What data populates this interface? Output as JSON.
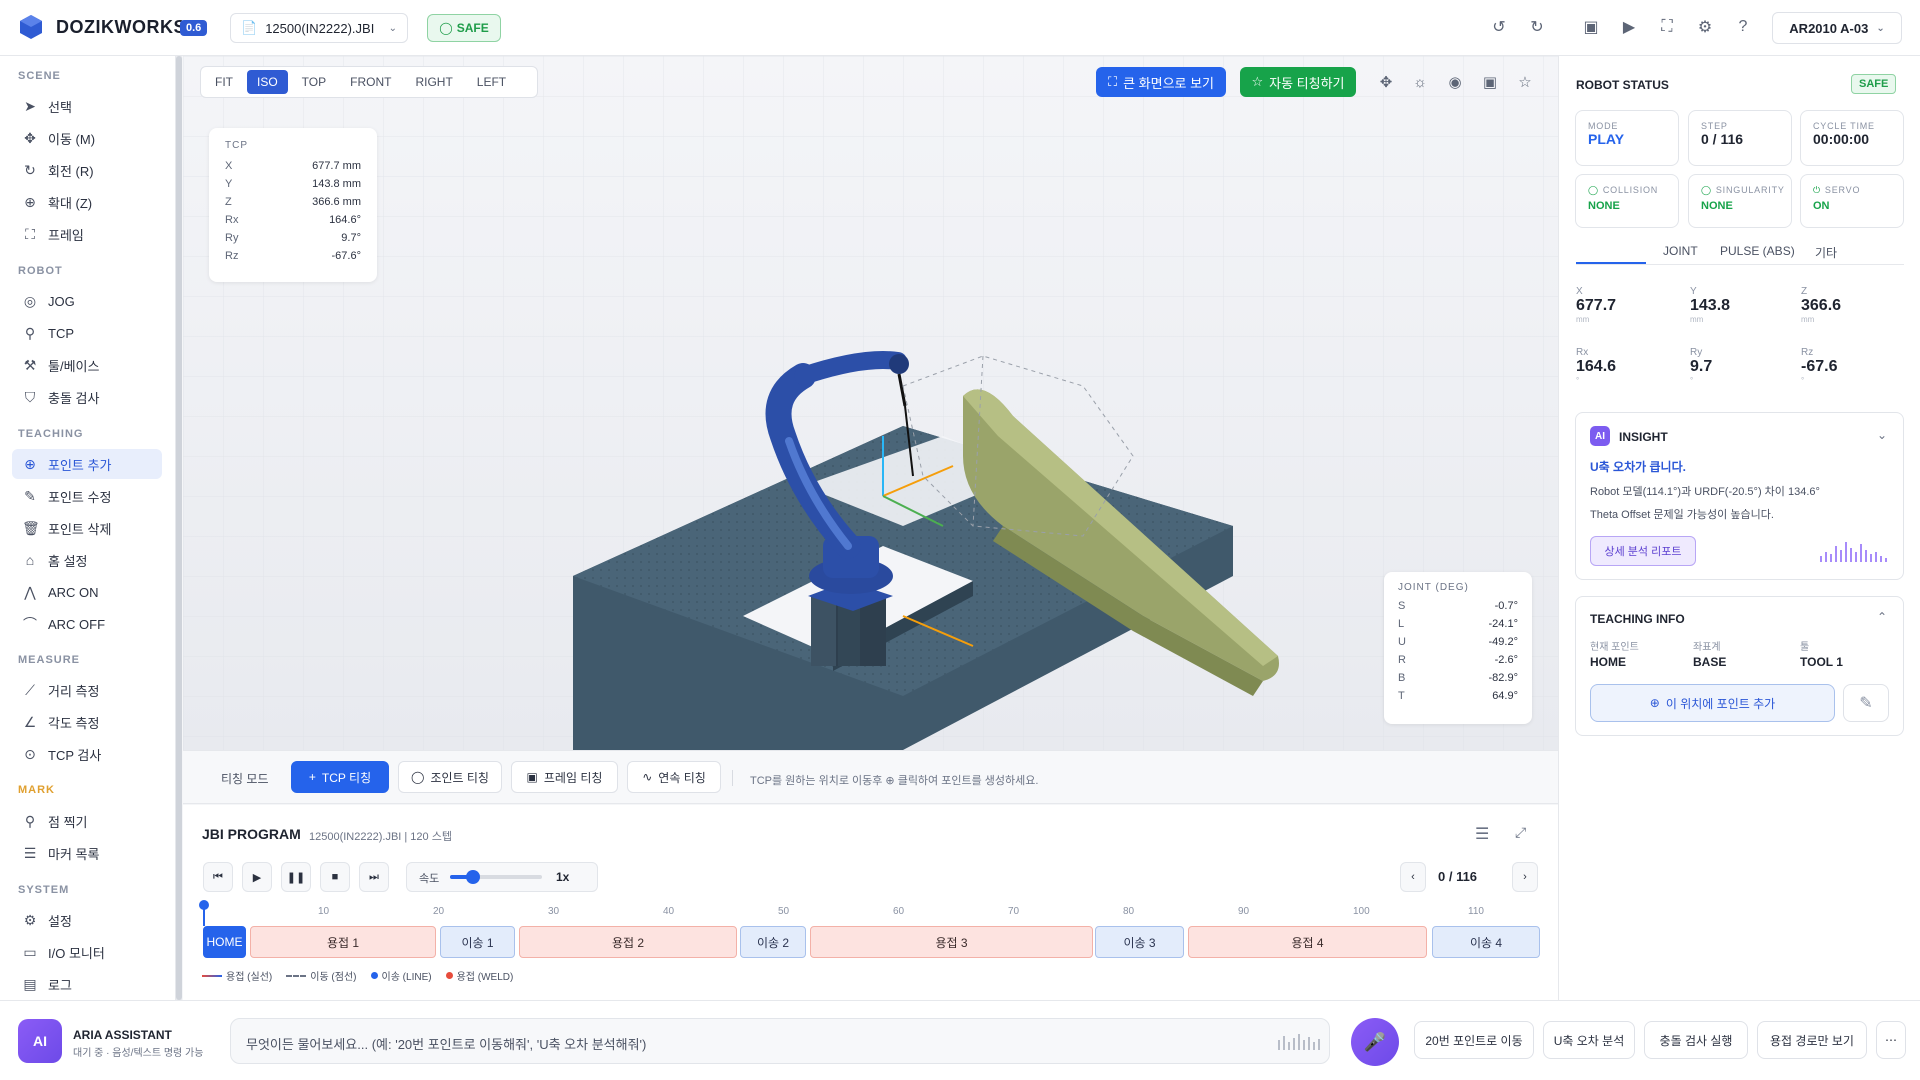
{
  "app": {
    "brand": "DOZIKWORKS",
    "version": "0.6",
    "file": "12500(IN2222).JBI",
    "safe": "SAFE",
    "robot_select": "AR2010 A-03"
  },
  "sidebar": {
    "sections": [
      {
        "title": "SCENE",
        "items": [
          {
            "label": "선택",
            "icon": "cursor-icon"
          },
          {
            "label": "이동 (M)",
            "icon": "move-icon"
          },
          {
            "label": "회전 (R)",
            "icon": "rotate-icon"
          },
          {
            "label": "확대 (Z)",
            "icon": "zoom-icon"
          },
          {
            "label": "프레임",
            "icon": "frame-icon"
          }
        ]
      },
      {
        "title": "ROBOT",
        "items": [
          {
            "label": "JOG",
            "icon": "jog-icon"
          },
          {
            "label": "TCP",
            "icon": "tcp-icon"
          },
          {
            "label": "툴/베이스",
            "icon": "wrench-icon"
          },
          {
            "label": "충돌 검사",
            "icon": "shield-icon"
          }
        ]
      },
      {
        "title": "TEACHING",
        "items": [
          {
            "label": "포인트 추가",
            "icon": "plus-circle-icon"
          },
          {
            "label": "포인트 수정",
            "icon": "edit-icon"
          },
          {
            "label": "포인트 삭제",
            "icon": "trash-icon"
          },
          {
            "label": "홈 설정",
            "icon": "home-icon"
          },
          {
            "label": "ARC ON",
            "icon": "arc-on-icon"
          },
          {
            "label": "ARC OFF",
            "icon": "arc-off-icon"
          }
        ]
      },
      {
        "title": "MEASURE",
        "items": [
          {
            "label": "거리 측정",
            "icon": "ruler-icon"
          },
          {
            "label": "각도 측정",
            "icon": "angle-icon"
          },
          {
            "label": "TCP 검사",
            "icon": "target-icon"
          }
        ]
      },
      {
        "title": "MARK",
        "items": [
          {
            "label": "점 찍기",
            "icon": "pin-icon"
          },
          {
            "label": "마커 목록",
            "icon": "list-icon"
          }
        ]
      },
      {
        "title": "SYSTEM",
        "items": [
          {
            "label": "설정",
            "icon": "gear-icon"
          },
          {
            "label": "I/O 모니터",
            "icon": "monitor-icon"
          },
          {
            "label": "로그",
            "icon": "log-icon"
          }
        ]
      }
    ]
  },
  "viewport": {
    "view_tabs": [
      "FIT",
      "ISO",
      "TOP",
      "FRONT",
      "RIGHT",
      "LEFT"
    ],
    "active_view": "ISO",
    "fullscreen_label": "큰 화면으로 보기",
    "auto_teach_label": "자동 티칭하기",
    "tcp": {
      "title": "TCP",
      "rows": [
        {
          "k": "X",
          "v": "677.7 mm"
        },
        {
          "k": "Y",
          "v": "143.8 mm"
        },
        {
          "k": "Z",
          "v": "366.6 mm"
        },
        {
          "k": "Rx",
          "v": "164.6°"
        },
        {
          "k": "Ry",
          "v": "9.7°"
        },
        {
          "k": "Rz",
          "v": "-67.6°"
        }
      ]
    },
    "joint": {
      "title": "JOINT (DEG)",
      "rows": [
        {
          "k": "S",
          "v": "-0.7°"
        },
        {
          "k": "L",
          "v": "-24.1°"
        },
        {
          "k": "U",
          "v": "-49.2°"
        },
        {
          "k": "R",
          "v": "-2.6°"
        },
        {
          "k": "B",
          "v": "-82.9°"
        },
        {
          "k": "T",
          "v": "64.9°"
        }
      ]
    }
  },
  "teaching": {
    "mode_label": "티칭 모드",
    "buttons": [
      "TCP 티칭",
      "조인트 티칭",
      "프레임 티칭",
      "연속 티칭"
    ],
    "hint": "TCP를 원하는 위치로 이동후 ⊕ 클릭하여 포인트를 생성하세요."
  },
  "program": {
    "title": "JBI PROGRAM",
    "subtitle": "12500(IN2222).JBI | 120 스텝",
    "speed_label": "속도",
    "speed_value": "1x",
    "speed_fraction": 0.25,
    "step": "0 / 116",
    "ticks": [
      "10",
      "20",
      "30",
      "40",
      "50",
      "60",
      "70",
      "80",
      "90",
      "100",
      "110"
    ],
    "segments": [
      {
        "label": "HOME",
        "type": "home"
      },
      {
        "label": "용접 1",
        "type": "weld"
      },
      {
        "label": "이송 1",
        "type": "move"
      },
      {
        "label": "용접 2",
        "type": "weld"
      },
      {
        "label": "이송 2",
        "type": "move"
      },
      {
        "label": "용접 3",
        "type": "weld"
      },
      {
        "label": "이송 3",
        "type": "move"
      },
      {
        "label": "용접 4",
        "type": "weld"
      },
      {
        "label": "이송 4",
        "type": "move"
      }
    ],
    "legend": [
      "용접 (실선)",
      "이동 (점선)",
      "이송 (LINE)",
      "용접 (WELD)"
    ]
  },
  "status": {
    "title": "ROBOT STATUS",
    "safe": "SAFE",
    "mode_k": "MODE",
    "mode_v": "PLAY",
    "step_k": "STEP",
    "step_v": "0 / 116",
    "cycle_k": "CYCLE TIME",
    "cycle_v": "00:00:00",
    "collision_k": "COLLISION",
    "collision_v": "NONE",
    "singularity_k": "SINGULARITY",
    "singularity_v": "NONE",
    "servo_k": "SERVO",
    "servo_v": "ON",
    "tabs": [
      "JOINT",
      "PULSE (ABS)",
      "기타"
    ],
    "coords": [
      {
        "k": "X",
        "v": "677.7",
        "u": "mm"
      },
      {
        "k": "Y",
        "v": "143.8",
        "u": "mm"
      },
      {
        "k": "Z",
        "v": "366.6",
        "u": "mm"
      },
      {
        "k": "Rx",
        "v": "164.6",
        "u": "°"
      },
      {
        "k": "Ry",
        "v": "9.7",
        "u": "°"
      },
      {
        "k": "Rz",
        "v": "-67.6",
        "u": "°"
      }
    ]
  },
  "insight": {
    "badge": "AI",
    "title": "INSIGHT",
    "headline": "U축 오차가 큽니다.",
    "line1": "Robot 모델(114.1°)과 URDF(-20.5°) 차이 134.6°",
    "line2": "Theta Offset 문제일 가능성이 높습니다.",
    "button": "상세 분석 리포트"
  },
  "teachinfo": {
    "title": "TEACHING INFO",
    "point_k": "현재 포인트",
    "point_v": "HOME",
    "coord_k": "좌표계",
    "coord_v": "BASE",
    "tool_k": "툴",
    "tool_v": "TOOL 1",
    "add_button": "이 위치에 포인트 추가"
  },
  "assistant": {
    "badge": "AI",
    "name": "ARIA ASSISTANT",
    "status": "대기 중 · 음성/텍스트 명령 가능",
    "placeholder": "무엇이든 물어보세요... (예: '20번 포인트로 이동해줘', 'U축 오차 분석해줘')",
    "quick": [
      "20번 포인트로 이동",
      "U축 오차 분석",
      "충돌 검사 실행",
      "용접 경로만 보기"
    ]
  },
  "colors": {
    "accent": "#2563eb",
    "green": "#17a34a",
    "weld": "#fde3e0",
    "move": "#e3ecfb",
    "robot": "#2c4fa8",
    "workpiece": "#9aa46a",
    "table": "#40596b"
  }
}
